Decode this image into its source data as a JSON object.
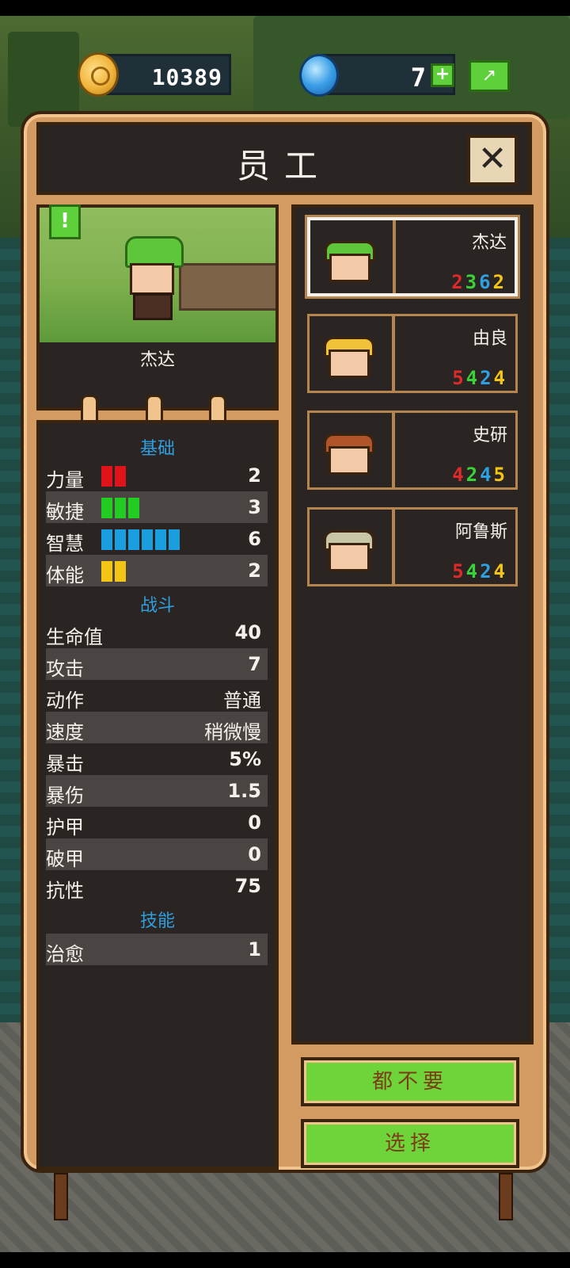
{
  "currency": {
    "coins": "10389",
    "gems": "7"
  },
  "dialog": {
    "title": "员工",
    "close_symbol": "✕"
  },
  "alert_badge": "!",
  "selected_hero": {
    "name": "杰达"
  },
  "sections": {
    "basic": "基础",
    "combat": "战斗",
    "skills": "技能"
  },
  "basic_stats": [
    {
      "label": "力量",
      "value": "2",
      "bar_count": 2,
      "color": "#e0121a"
    },
    {
      "label": "敏捷",
      "value": "3",
      "bar_count": 3,
      "color": "#22cc22"
    },
    {
      "label": "智慧",
      "value": "6",
      "bar_count": 6,
      "color": "#1a9ee0"
    },
    {
      "label": "体能",
      "value": "2",
      "bar_count": 2,
      "color": "#f4c514"
    }
  ],
  "combat_stats": [
    {
      "label": "生命值",
      "value": "40"
    },
    {
      "label": "攻击",
      "value": "7"
    },
    {
      "label": "动作",
      "value": "普通"
    },
    {
      "label": "速度",
      "value": "稍微慢"
    },
    {
      "label": "暴击",
      "value": "5%"
    },
    {
      "label": "暴伤",
      "value": "1.5"
    },
    {
      "label": "护甲",
      "value": "0"
    },
    {
      "label": "破甲",
      "value": "0"
    },
    {
      "label": "抗性",
      "value": "75"
    }
  ],
  "skills": [
    {
      "label": "治愈",
      "value": "1"
    }
  ],
  "employees": [
    {
      "name": "杰达",
      "stats": [
        "2",
        "3",
        "6",
        "2"
      ],
      "selected": true,
      "hair": "#5ec63a"
    },
    {
      "name": "由良",
      "stats": [
        "5",
        "4",
        "2",
        "4"
      ],
      "selected": false,
      "hair": "#f0c23a"
    },
    {
      "name": "史研",
      "stats": [
        "4",
        "2",
        "4",
        "5"
      ],
      "selected": false,
      "hair": "#b0552a"
    },
    {
      "name": "阿鲁斯",
      "stats": [
        "5",
        "4",
        "2",
        "4"
      ],
      "selected": false,
      "hair": "#c9c6a8"
    }
  ],
  "buttons": {
    "reject_all": "都不要",
    "select": "选择"
  }
}
